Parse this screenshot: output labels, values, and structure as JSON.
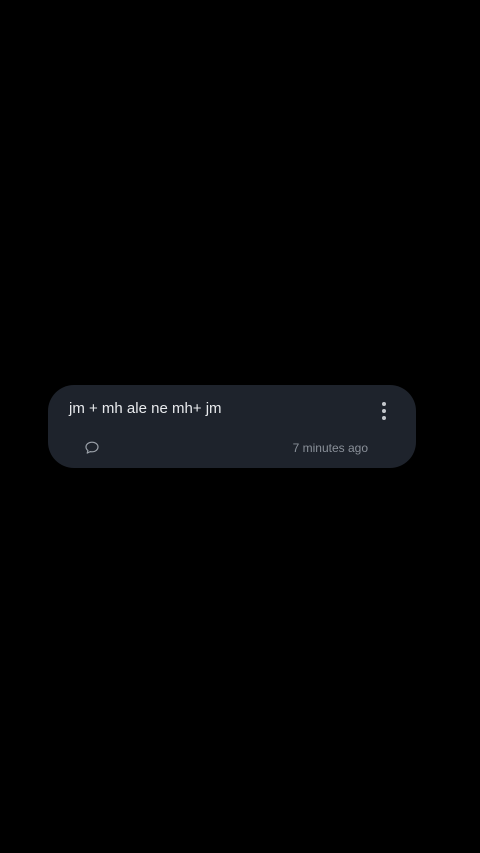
{
  "card": {
    "message": "jm + mh ale ne mh+ jm",
    "timestamp": "7 minutes ago",
    "comment_icon": "comment-bubble-icon",
    "more_icon": "more-vertical-icon"
  },
  "colors": {
    "background": "#000000",
    "card": "#1e232c",
    "text": "#e8eaed",
    "muted": "#8a9099"
  }
}
